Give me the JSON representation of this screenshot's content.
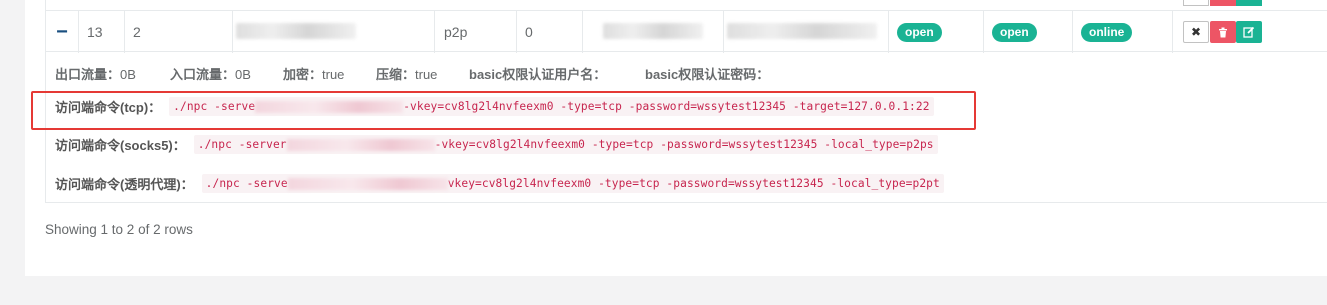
{
  "row": {
    "toggle_icon": "minus-icon",
    "id": "13",
    "client_id": "2",
    "mode": "p2p",
    "flow": "0",
    "status1": "open",
    "status2": "open",
    "status3": "online",
    "actions": [
      "close-icon",
      "trash-icon",
      "edit-icon"
    ]
  },
  "detail": {
    "out_label": "出口流量：",
    "out_value": "0B",
    "in_label": "入口流量：",
    "in_value": "0B",
    "encrypt_label": "加密：",
    "encrypt_value": "true",
    "compress_label": "压缩：",
    "compress_value": "true",
    "basic_user_label": "basic权限认证用户名：",
    "basic_pass_label": "basic权限认证密码："
  },
  "commands": [
    {
      "label": "访问端命令(tcp)：",
      "prefix": "./npc -serve",
      "suffix": "-vkey=cv8lg2l4nvfeexm0 -type=tcp -password=wssytest12345 -target=127.0.0.1:22"
    },
    {
      "label": "访问端命令(socks5)：",
      "prefix": "./npc -server",
      "suffix": "-vkey=cv8lg2l4nvfeexm0 -type=tcp -password=wssytest12345 -local_type=p2ps"
    },
    {
      "label": "访问端命令(透明代理)：",
      "prefix": "./npc -serve",
      "suffix": "vkey=cv8lg2l4nvfeexm0 -type=tcp -password=wssytest12345 -local_type=p2pt"
    }
  ],
  "footer": {
    "pagination_text": "Showing 1 to 2 of 2 rows"
  },
  "colors": {
    "accent": "#1ab394",
    "danger": "#ed5565",
    "code_text": "#c7254e",
    "highlight_border": "#e53935"
  }
}
